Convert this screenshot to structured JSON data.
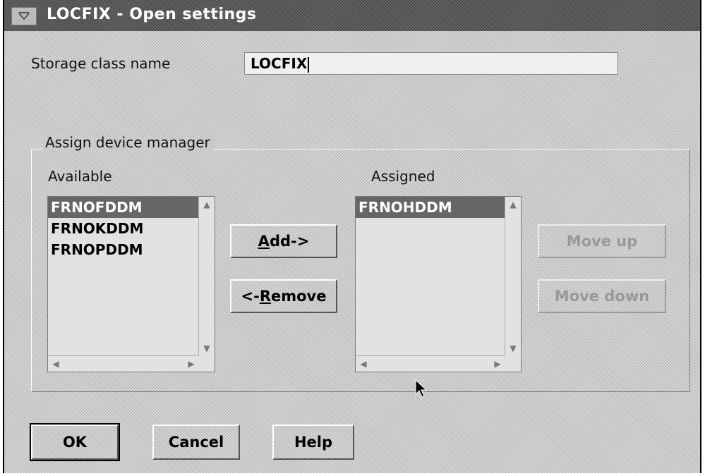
{
  "window": {
    "title": "LOCFIX - Open settings"
  },
  "storage_class": {
    "label": "Storage class name",
    "value": "LOCFIX"
  },
  "group": {
    "title": "Assign device manager",
    "available_label": "Available",
    "assigned_label": "Assigned",
    "available_items": [
      "FRNOFDDM",
      "FRNOKDDM",
      "FRNOPDDM"
    ],
    "available_selected_index": 0,
    "assigned_items": [
      "FRNOHDDM"
    ],
    "assigned_selected_index": 0
  },
  "buttons": {
    "add": {
      "pre": "",
      "mnemonic": "A",
      "post": "dd->"
    },
    "remove": {
      "pre": "<-",
      "mnemonic": "R",
      "post": "emove"
    },
    "move_up": "Move up",
    "move_down": "Move down",
    "ok": "OK",
    "cancel": "Cancel",
    "help": "Help"
  }
}
